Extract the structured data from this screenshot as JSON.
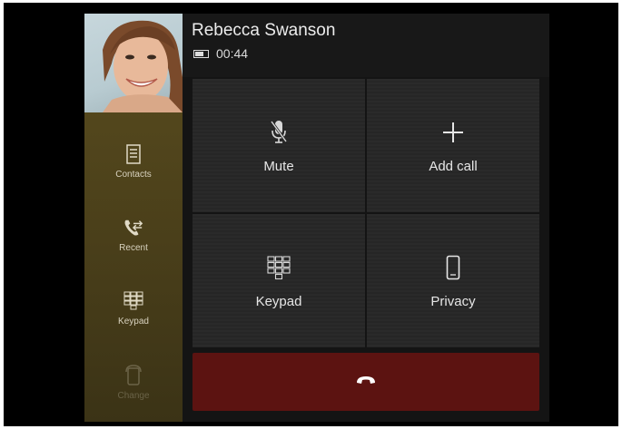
{
  "call": {
    "caller_name": "Rebecca Swanson",
    "duration": "00:44"
  },
  "sidebar": {
    "items": [
      {
        "label": "Contacts",
        "icon": "contacts-icon"
      },
      {
        "label": "Recent",
        "icon": "recent-calls-icon"
      },
      {
        "label": "Keypad",
        "icon": "keypad-icon"
      },
      {
        "label": "Change",
        "icon": "change-phone-icon",
        "disabled": true
      }
    ]
  },
  "actions": [
    {
      "label": "Mute",
      "icon": "microphone-muted-icon"
    },
    {
      "label": "Add call",
      "icon": "plus-icon"
    },
    {
      "label": "Keypad",
      "icon": "keypad-icon"
    },
    {
      "label": "Privacy",
      "icon": "phone-device-icon"
    }
  ],
  "hangup": {
    "icon": "end-call-icon"
  },
  "colors": {
    "sidebar": "#5a4d1e",
    "hangup": "#5c1311",
    "tile": "#2a2a2a",
    "background": "#141414"
  }
}
